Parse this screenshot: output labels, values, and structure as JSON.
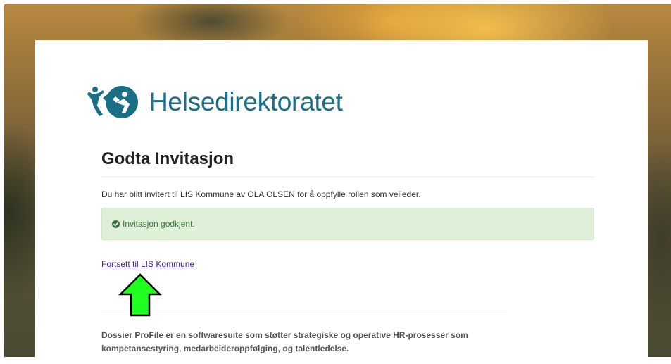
{
  "brand": {
    "name": "Helsedirektoratet",
    "logo_icon": "helsedirektoratet-logo-icon",
    "color": "#1a6f86"
  },
  "page": {
    "title": "Godta Invitasjon",
    "intro": "Du har blitt invitert til LIS Kommune av OLA OLSEN for å oppfylle rollen som veileder."
  },
  "alert": {
    "icon": "check-circle-icon",
    "message": "Invitasjon godkjent.",
    "background": "#dff0d8",
    "text_color": "#3c763d"
  },
  "continue_link": {
    "label": "Fortsett til LIS Kommune",
    "color": "#3b2a8a"
  },
  "annotation": {
    "icon": "green-up-arrow-icon",
    "color": "#21ff21"
  },
  "footer": {
    "line1": "Dossier ProFile er en softwaresuite som støtter strategiske og operative HR-prosesser som",
    "line2": "kompetansestyring, medarbeideroppfølging, og talentledelse."
  }
}
